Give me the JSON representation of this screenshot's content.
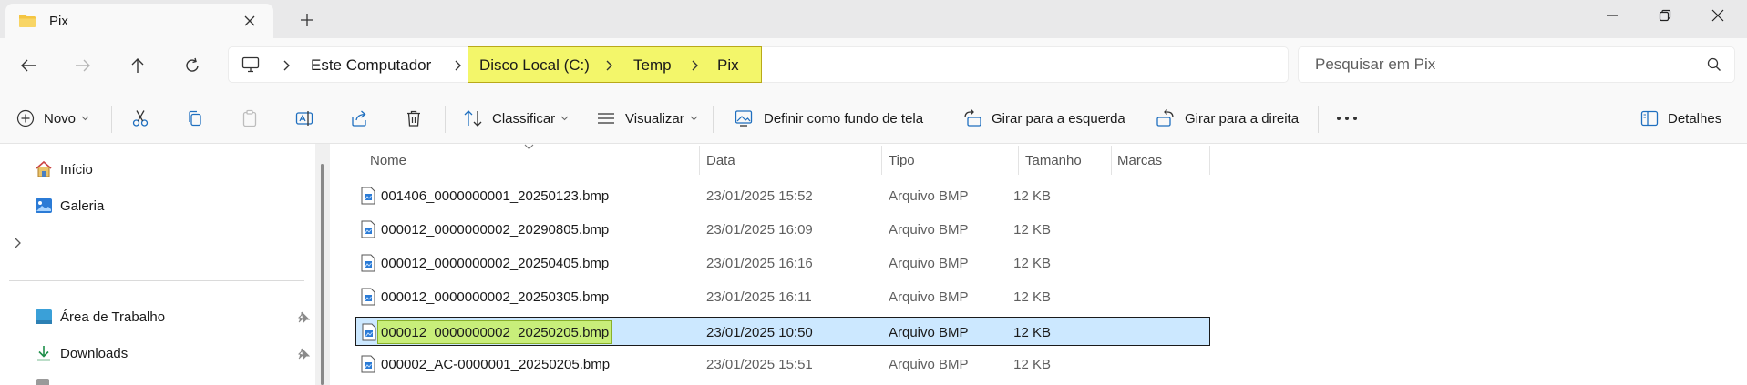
{
  "window": {
    "tab_title": "Pix",
    "colors": {
      "folder": "#f4c542",
      "selection": "#cce8ff",
      "highlight_yellow": "#f3f66a",
      "highlight_green": "#c8ee7a"
    }
  },
  "address": {
    "crumbs": [
      "Este Computador",
      "Disco Local (C:)",
      "Temp",
      "Pix"
    ]
  },
  "search": {
    "placeholder": "Pesquisar em Pix"
  },
  "commands": {
    "new": "Novo",
    "sort": "Classificar",
    "view": "Visualizar",
    "set_wallpaper": "Definir como fundo de tela",
    "rotate_left": "Girar para a esquerda",
    "rotate_right": "Girar para a direita",
    "details": "Detalhes"
  },
  "sidebar": {
    "home": "Início",
    "gallery": "Galeria",
    "desktop": "Área de Trabalho",
    "downloads": "Downloads"
  },
  "columns": {
    "name": "Nome",
    "date": "Data",
    "type": "Tipo",
    "size": "Tamanho",
    "tags": "Marcas"
  },
  "files": [
    {
      "name": "001406_0000000001_20250123.bmp",
      "date": "23/01/2025 15:52",
      "type": "Arquivo BMP",
      "size": "12 KB"
    },
    {
      "name": "000012_0000000002_20290805.bmp",
      "date": "23/01/2025 16:09",
      "type": "Arquivo BMP",
      "size": "12 KB"
    },
    {
      "name": "000012_0000000002_20250405.bmp",
      "date": "23/01/2025 16:16",
      "type": "Arquivo BMP",
      "size": "12 KB"
    },
    {
      "name": "000012_0000000002_20250305.bmp",
      "date": "23/01/2025 16:11",
      "type": "Arquivo BMP",
      "size": "12 KB"
    },
    {
      "name": "000012_0000000002_20250205.bmp",
      "date": "23/01/2025 10:50",
      "type": "Arquivo BMP",
      "size": "12 KB",
      "selected": true
    },
    {
      "name": "000002_AC-0000001_20250205.bmp",
      "date": "23/01/2025 15:51",
      "type": "Arquivo BMP",
      "size": "12 KB"
    }
  ]
}
